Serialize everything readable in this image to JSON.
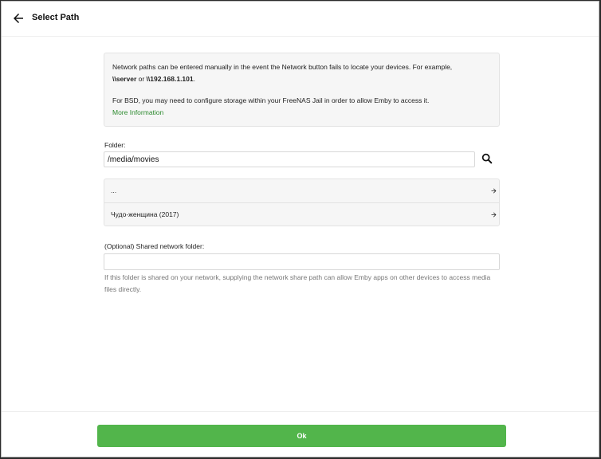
{
  "header": {
    "title": "Select Path",
    "back_icon": "arrow-left-icon"
  },
  "info": {
    "line1": "Network paths can be entered manually in the event the Network button fails to locate your devices. For example,",
    "example_server": "\\\\server",
    "example_or": " or ",
    "example_ip": "\\\\192.168.1.101",
    "example_end": ".",
    "line2": "For BSD, you may need to configure storage within your FreeNAS Jail in order to allow Emby to access it.",
    "more_link": "More Information"
  },
  "folder": {
    "label": "Folder:",
    "value": "/media/movies",
    "search_icon": "search-icon"
  },
  "directory_list": [
    {
      "label": "..."
    },
    {
      "label": "Чудо-женщина (2017)"
    }
  ],
  "shared": {
    "label": "(Optional) Shared network folder:",
    "value": "",
    "help": "If this folder is shared on your network, supplying the network share path can allow Emby apps on other devices to access media files directly."
  },
  "footer": {
    "ok_label": "Ok"
  },
  "colors": {
    "accent": "#52b54b",
    "link": "#2e8b30",
    "panel_bg": "#f6f6f6"
  }
}
